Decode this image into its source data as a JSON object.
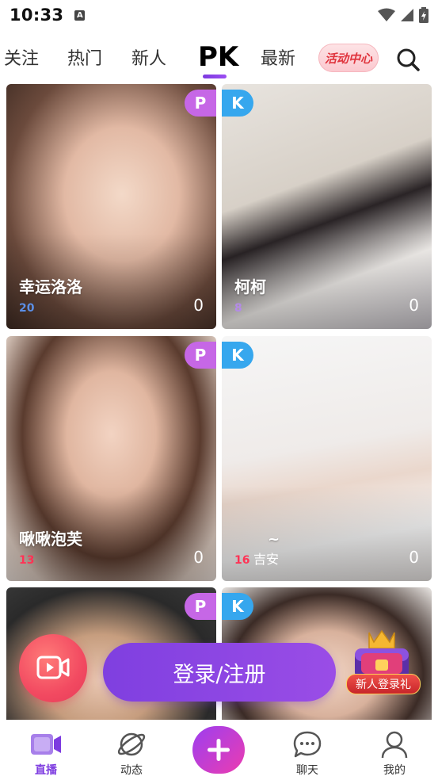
{
  "status_bar": {
    "time": "10:33",
    "notification_icon": "A"
  },
  "tabs": [
    {
      "label": "关注"
    },
    {
      "label": "热门"
    },
    {
      "label": "新人"
    },
    {
      "label": "PK"
    },
    {
      "label": "最新"
    }
  ],
  "active_tab": "PK",
  "activity_button": {
    "label": "活动中心"
  },
  "cards": [
    {
      "name": "幸运洛洛",
      "level": "20",
      "level_color": "#5b8fe6",
      "count": "0",
      "badge": "P"
    },
    {
      "name": "柯柯",
      "level": "8",
      "level_color": "#b48ae8",
      "count": "0",
      "badge": "K"
    },
    {
      "name": "啾啾泡芙",
      "level": "13",
      "level_color": "#ff3355",
      "count": "0",
      "badge": "P"
    },
    {
      "name": "~",
      "name_suffix": "吉安",
      "level": "16",
      "level_color": "#ff3355",
      "count": "0",
      "badge": "K"
    },
    {
      "name": "",
      "level": "",
      "count": "",
      "badge": "P"
    },
    {
      "name": "",
      "level": "",
      "count": "",
      "badge": "K"
    }
  ],
  "login_button": {
    "label": "登录/注册"
  },
  "gift": {
    "label": "新人登录礼"
  },
  "bottom_nav": [
    {
      "label": "直播",
      "icon": "live-video-icon"
    },
    {
      "label": "动态",
      "icon": "planet-icon"
    },
    {
      "label": "",
      "icon": "plus-icon"
    },
    {
      "label": "聊天",
      "icon": "chat-bubble-icon"
    },
    {
      "label": "我的",
      "icon": "person-icon"
    }
  ],
  "colors": {
    "accent": "#7d3be0",
    "badge_p": "#c667e6",
    "badge_k": "#36a7ee",
    "activity_text": "#e0353e"
  }
}
